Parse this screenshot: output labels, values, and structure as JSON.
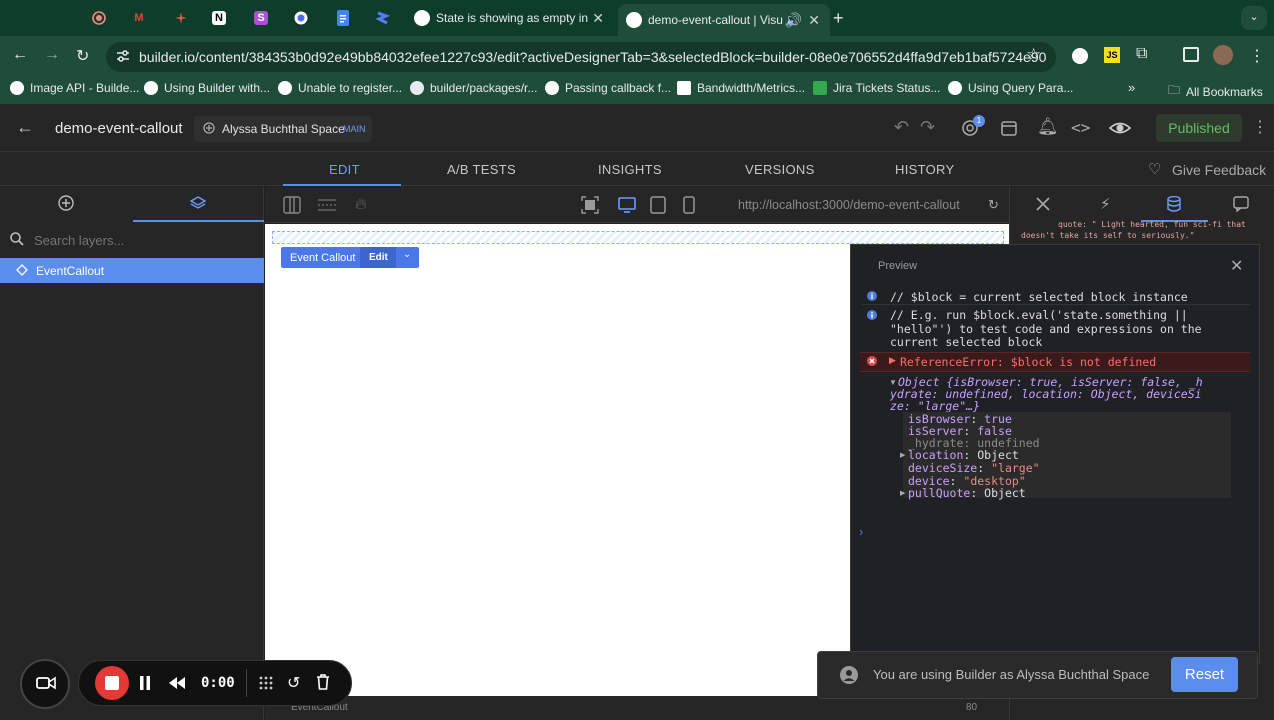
{
  "browser": {
    "tabs": [
      {
        "title": "State is showing as empty in",
        "active": false
      },
      {
        "title": "demo-event-callout | Visu",
        "active": true
      }
    ],
    "url": "builder.io/content/384353b0d92e49bb84032efee1227c93/edit?activeDesignerTab=3&selectedBlock=builder-08e0e706552d4ffa9d7eb1baf5724e90",
    "bookmarks": [
      "Image API - Builde...",
      "Using Builder with...",
      "Unable to register...",
      "builder/packages/r...",
      "Passing callback f...",
      "Bandwidth/Metrics...",
      "Jira Tickets Status...",
      "Using Query Para..."
    ],
    "all_bookmarks": "All Bookmarks"
  },
  "header": {
    "content_name": "demo-event-callout",
    "space_name": "Alyssa Buchthal Space",
    "space_badge": "MAIN",
    "notification_count": "1",
    "published_label": "Published"
  },
  "top_tabs": [
    "EDIT",
    "A/B TESTS",
    "INSIGHTS",
    "VERSIONS",
    "HISTORY"
  ],
  "give_feedback": "Give Feedback",
  "layers": {
    "search_placeholder": "Search layers...",
    "items": [
      "EventCallout"
    ]
  },
  "canvas": {
    "preview_url": "http://localhost:3000/demo-event-callout",
    "block_label": "Event Callout",
    "edit_label": "Edit",
    "breadcrumb": "EventCallout",
    "zoom": "80"
  },
  "right_panel": {
    "snippet_line1": "quote: \" Light hearted, fun sci-fi that",
    "snippet_line2": "doesn't take its self to seriously.\""
  },
  "console": {
    "title": "Preview",
    "info1": "// $block = current selected block instance",
    "info2": "// E.g. run $block.eval('state.something ||\n\"hello\"') to test code and expressions on the\ncurrent selected block",
    "error": "ReferenceError: $block is not defined",
    "object_line1": "Object {isBrowser: true, isServer: false, _h",
    "object_line2": "ydrate: undefined, location: Object, deviceSi",
    "object_line3": "ze: \"large\"…}",
    "props": [
      {
        "key": "isBrowser",
        "value": "true",
        "expandable": false
      },
      {
        "key": "isServer",
        "value": "false",
        "expandable": false
      },
      {
        "key": "_hydrate",
        "value": "undefined",
        "expandable": false
      },
      {
        "key": "location",
        "value": "Object",
        "expandable": true
      },
      {
        "key": "deviceSize",
        "value": "\"large\"",
        "expandable": false
      },
      {
        "key": "device",
        "value": "\"desktop\"",
        "expandable": false
      },
      {
        "key": "pullQuote",
        "value": "Object",
        "expandable": true
      }
    ]
  },
  "notice": {
    "text": "You are using Builder as Alyssa Buchthal Space",
    "reset_label": "Reset"
  },
  "recorder": {
    "time": "0:00"
  },
  "colors": {
    "accent": "#5b8def",
    "published": "#4caf50",
    "error": "#ff6b6b",
    "chrome_green": "#1f4d3a"
  }
}
